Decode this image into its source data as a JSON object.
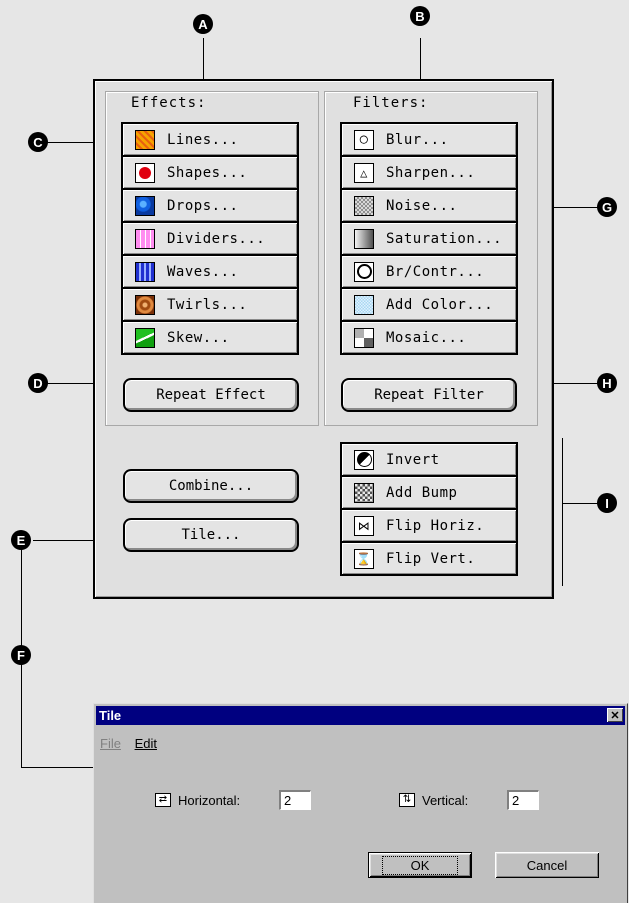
{
  "callouts": {
    "a": "A",
    "b": "B",
    "c": "C",
    "d": "D",
    "e": "E",
    "f": "F",
    "g": "G",
    "h": "H",
    "i": "I"
  },
  "effects": {
    "label": "Effects:",
    "items": [
      {
        "label": "Lines...",
        "icon": "lines-icon"
      },
      {
        "label": "Shapes...",
        "icon": "shapes-icon"
      },
      {
        "label": "Drops...",
        "icon": "drops-icon"
      },
      {
        "label": "Dividers...",
        "icon": "dividers-icon"
      },
      {
        "label": "Waves...",
        "icon": "waves-icon"
      },
      {
        "label": "Twirls...",
        "icon": "twirls-icon"
      },
      {
        "label": "Skew...",
        "icon": "skew-icon"
      }
    ],
    "repeat_label": "Repeat Effect"
  },
  "filters": {
    "label": "Filters:",
    "items": [
      {
        "label": "Blur...",
        "icon": "blur-icon"
      },
      {
        "label": "Sharpen...",
        "icon": "sharpen-icon"
      },
      {
        "label": "Noise...",
        "icon": "noise-icon"
      },
      {
        "label": "Saturation...",
        "icon": "saturation-icon"
      },
      {
        "label": "Br/Contr...",
        "icon": "brightness-contrast-icon"
      },
      {
        "label": "Add Color...",
        "icon": "add-color-icon"
      },
      {
        "label": "Mosaic...",
        "icon": "mosaic-icon"
      }
    ],
    "repeat_label": "Repeat Filter"
  },
  "combine_label": "Combine...",
  "tile_label": "Tile...",
  "transforms": [
    {
      "label": "Invert",
      "icon": "invert-icon"
    },
    {
      "label": "Add Bump",
      "icon": "add-bump-icon"
    },
    {
      "label": "Flip Horiz.",
      "icon": "flip-horizontal-icon"
    },
    {
      "label": "Flip Vert.",
      "icon": "flip-vertical-icon"
    }
  ],
  "dialog": {
    "title": "Tile",
    "close": "✕",
    "menu": [
      "File",
      "Edit"
    ],
    "horizontal_label": "Horizontal:",
    "horizontal_value": "2",
    "vertical_label": "Vertical:",
    "vertical_value": "2",
    "ok_label": "OK",
    "cancel_label": "Cancel"
  }
}
